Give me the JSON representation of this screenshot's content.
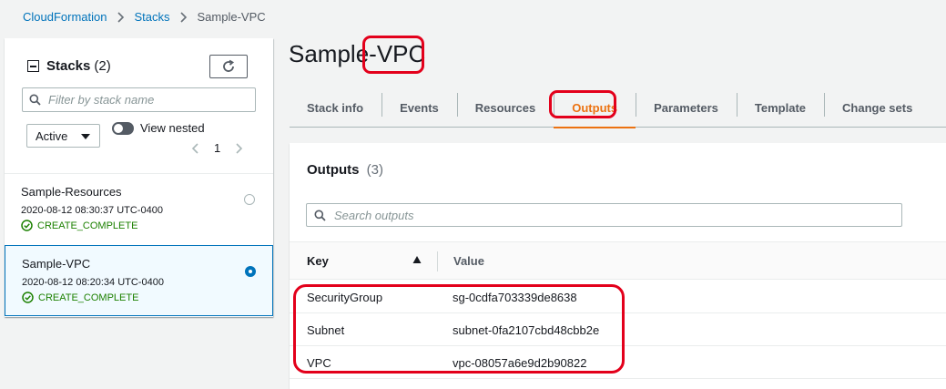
{
  "breadcrumb": {
    "items": [
      "CloudFormation",
      "Stacks"
    ],
    "current": "Sample-VPC"
  },
  "stacks_panel": {
    "title": "Stacks",
    "count": "(2)",
    "filter_placeholder": "Filter by stack name",
    "status_filter": "Active",
    "view_nested_label": "View nested",
    "page": "1",
    "stacks": [
      {
        "name": "Sample-Resources",
        "date": "2020-08-12 08:30:37 UTC-0400",
        "status": "CREATE_COMPLETE",
        "selected": false
      },
      {
        "name": "Sample-VPC",
        "date": "2020-08-12 08:20:34 UTC-0400",
        "status": "CREATE_COMPLETE",
        "selected": true
      }
    ]
  },
  "page_title": "Sample-VPC",
  "tabs": [
    "Stack info",
    "Events",
    "Resources",
    "Outputs",
    "Parameters",
    "Template",
    "Change sets"
  ],
  "active_tab": "Outputs",
  "outputs": {
    "title": "Outputs",
    "count": "(3)",
    "search_placeholder": "Search outputs",
    "columns": {
      "key": "Key",
      "value": "Value"
    },
    "rows": [
      {
        "key": "SecurityGroup",
        "value": "sg-0cdfa703339de8638"
      },
      {
        "key": "Subnet",
        "value": "subnet-0fa2107cbd48cbb2e"
      },
      {
        "key": "VPC",
        "value": "vpc-08057a6e9d2b90822"
      }
    ]
  },
  "colors": {
    "link": "#0073bb",
    "active_tab": "#ec7211",
    "success": "#1d8102",
    "annotation": "#e3001b"
  }
}
